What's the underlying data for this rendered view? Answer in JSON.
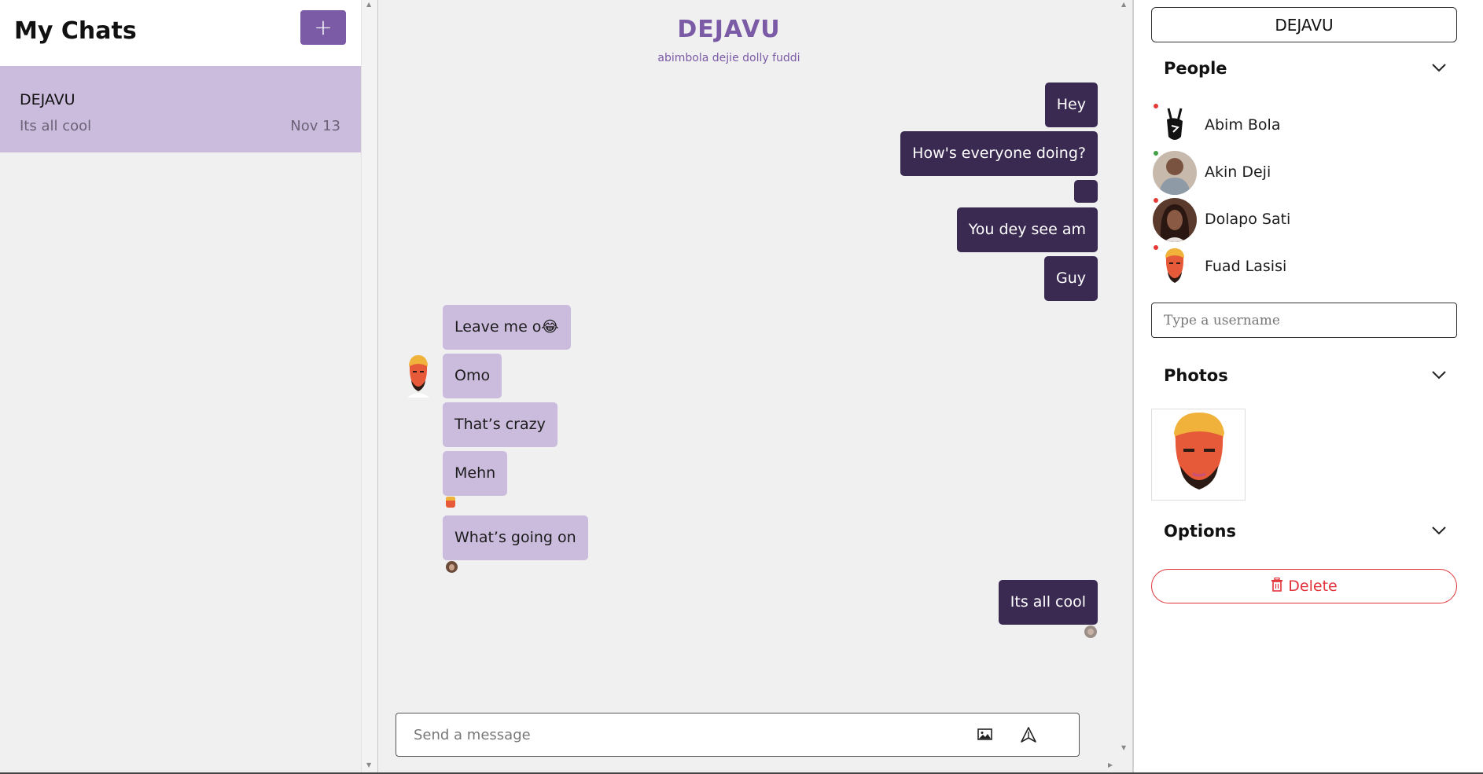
{
  "left_panel": {
    "title": "My Chats",
    "new_chat_label": "+",
    "chats": [
      {
        "title": "DEJAVU",
        "last_message": "Its all cool",
        "date": "Nov 13"
      }
    ]
  },
  "chat": {
    "title": "DEJAVU",
    "members": "abimbola dejie dolly fuddi",
    "messages": [
      {
        "text": "Hey",
        "direction": "out"
      },
      {
        "text": "How's everyone doing?",
        "direction": "out"
      },
      {
        "text": "",
        "direction": "out"
      },
      {
        "text": "You dey see am",
        "direction": "out"
      },
      {
        "text": "Guy",
        "direction": "out"
      },
      {
        "text": "Leave me o😂",
        "direction": "in"
      },
      {
        "text": "Omo",
        "direction": "in"
      },
      {
        "text": "That’s crazy",
        "direction": "in"
      },
      {
        "text": "Mehn",
        "direction": "in"
      },
      {
        "text": "What’s going on",
        "direction": "in"
      },
      {
        "text": "Its all cool",
        "direction": "out"
      }
    ],
    "composer_placeholder": "Send a message"
  },
  "right_panel": {
    "title": "DEJAVU",
    "people_label": "People",
    "people": [
      {
        "name": "Abim Bola",
        "status_color": "#e53935"
      },
      {
        "name": "Akin Deji",
        "status_color": "#43a047"
      },
      {
        "name": "Dolapo Sati",
        "status_color": "#e53935"
      },
      {
        "name": "Fuad Lasisi",
        "status_color": "#e53935"
      }
    ],
    "username_placeholder": "Type a username",
    "photos_label": "Photos",
    "options_label": "Options",
    "delete_label": "Delete"
  },
  "colors": {
    "accent": "#7b5aa6",
    "outgoing_bubble": "#3a2a52",
    "incoming_bubble": "#cbbcde",
    "danger": "#e0343a"
  }
}
